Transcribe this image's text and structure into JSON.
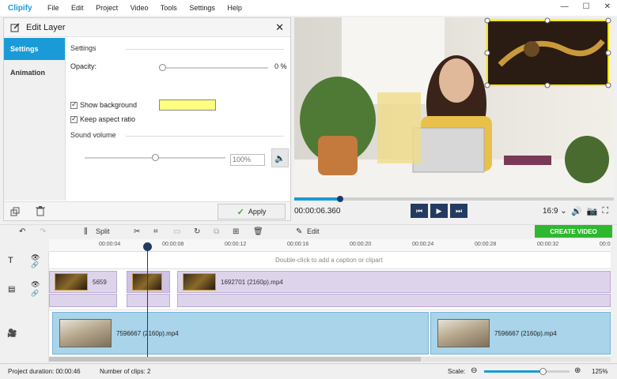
{
  "app": {
    "name": "Clipify"
  },
  "menu": [
    "File",
    "Edit",
    "Project",
    "Video",
    "Tools",
    "Settings",
    "Help"
  ],
  "window_controls": {
    "minimize": "—",
    "maximize": "☐",
    "close": "✕"
  },
  "panel": {
    "title": "Edit Layer",
    "close": "✕",
    "tabs": [
      "Settings",
      "Animation"
    ],
    "section_settings": "Settings",
    "opacity_label": "Opacity:",
    "opacity_value": "0 %",
    "opacity_level": 0,
    "show_background_label": "Show background",
    "show_background_checked": true,
    "background_color": "#ffff80",
    "keep_aspect_label": "Keep aspect ratio",
    "keep_aspect_checked": true,
    "section_sound": "Sound volume",
    "volume_value": "100%",
    "volume_level": 0.5,
    "apply_label": "Apply"
  },
  "player": {
    "timecode": "00:00:06.360",
    "aspect": "16:9 ⌄",
    "progress": 0.14
  },
  "toolbar": {
    "split_label": "Split",
    "edit_label": "Edit",
    "create_video_label": "CREATE VIDEO"
  },
  "timeline": {
    "ticks": [
      "00:00:04",
      "00:00:08",
      "00:00:12",
      "00:00:16",
      "00:00:20",
      "00:00:24",
      "00:00:28",
      "00:00:32",
      "00:0"
    ],
    "caption_hint": "Double-click to add a caption or clipart",
    "overlay_clips": [
      "5659",
      "",
      "1692701 (2160p).mp4"
    ],
    "main_clips": [
      "7596667 (2160p).mp4",
      "7596667 (2160p).mp4"
    ]
  },
  "status": {
    "duration_label": "Project duration: 00:00:46",
    "clips_label": "Number of clips: 2",
    "scale_label": "Scale:",
    "scale_value": "125%"
  },
  "colors": {
    "accent": "#1a9bd7",
    "navy": "#243b61",
    "create": "#2eb82e",
    "overlay_clip": "#ddd4ec",
    "main_clip": "#a9d4ea"
  }
}
